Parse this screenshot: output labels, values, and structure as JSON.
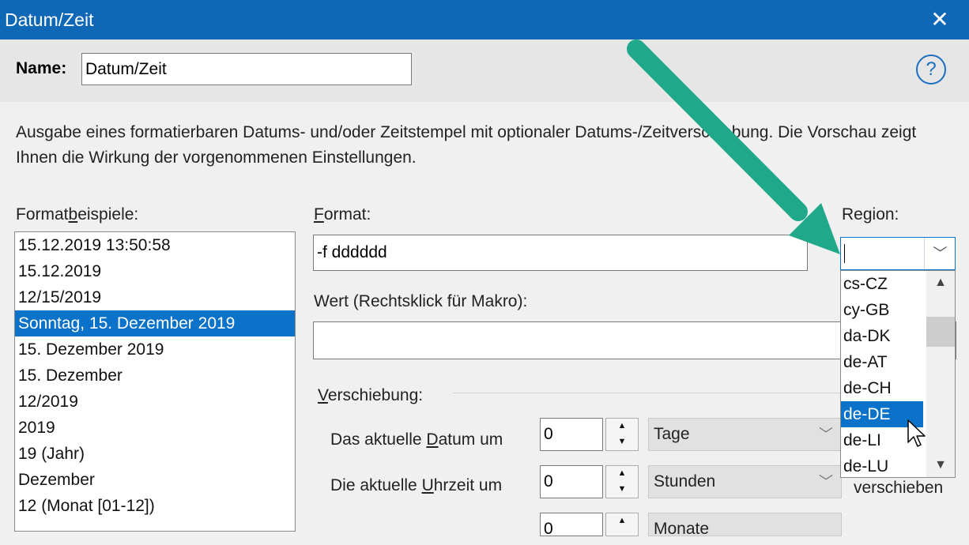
{
  "window": {
    "title": "Datum/Zeit",
    "close_glyph": "✕"
  },
  "name": {
    "label": "Name:",
    "value": "Datum/Zeit"
  },
  "help": {
    "glyph": "?"
  },
  "description": "Ausgabe eines formatierbaren Datums- und/oder Zeitstempel mit optionaler Datums-/Zeitverschiebung. Die Vorschau zeigt Ihnen die Wirkung der vorgenommenen Einstellungen.",
  "format_examples": {
    "label_pre": "Format",
    "label_u": "b",
    "label_post": "eispiele:",
    "items": [
      "15.12.2019 13:50:58",
      "15.12.2019",
      "12/15/2019",
      "Sonntag, 15. Dezember 2019",
      "15. Dezember 2019",
      "15. Dezember",
      "12/2019",
      "2019",
      "19 (Jahr)",
      "Dezember",
      "12 (Monat [01-12])"
    ],
    "selected_index": 3
  },
  "format": {
    "label_u": "F",
    "label_post": "ormat:",
    "value": "-f dddddd"
  },
  "wert": {
    "label": "Wert (Rechtsklick für Makro):",
    "value": ""
  },
  "region": {
    "label": "Region:",
    "value": "",
    "options": [
      "cs-CZ",
      "cy-GB",
      "da-DK",
      "de-AT",
      "de-CH",
      "de-DE",
      "de-LI",
      "de-LU"
    ],
    "selected_index": 5,
    "chevron": "﹀",
    "scroll_up": "▲",
    "scroll_down": "▼"
  },
  "shift": {
    "group_label_u": "V",
    "group_label_post": "erschiebung:",
    "date_row": {
      "label_pre": "Das aktuelle ",
      "label_u": "D",
      "label_post": "atum um",
      "value": "0",
      "unit": "Tage"
    },
    "time_row": {
      "label_pre": "Die aktuelle ",
      "label_u": "U",
      "label_post": "hrzeit um",
      "value": "0",
      "unit": "Stunden",
      "suffix": "verschieben"
    },
    "third_row": {
      "value": "0",
      "unit": "Monate"
    },
    "spin_up": "▲",
    "spin_down": "▼",
    "combo_chevron": "﹀"
  },
  "annotation": {
    "arrow_color": "#1fa98a"
  },
  "colors": {
    "titlebar": "#0f68b6",
    "selection": "#0a72c8",
    "accent": "#1d6fbf"
  }
}
